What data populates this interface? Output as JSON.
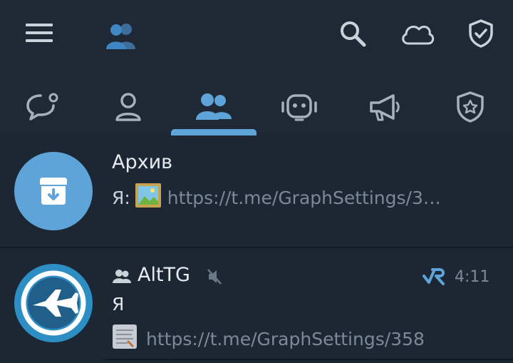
{
  "header": {
    "menu_icon": "hamburger-menu-icon",
    "contacts_icon": "people-emoji-icon",
    "search_icon": "search-icon",
    "cloud_icon": "cloud-icon",
    "shield_icon": "shield-check-icon"
  },
  "tabs": [
    {
      "icon": "chat-bubble-icon",
      "active": false
    },
    {
      "icon": "person-icon",
      "active": false
    },
    {
      "icon": "group-icon",
      "active": true
    },
    {
      "icon": "robot-icon",
      "active": false
    },
    {
      "icon": "megaphone-icon",
      "active": false
    },
    {
      "icon": "star-shield-icon",
      "active": false
    }
  ],
  "chats": [
    {
      "title": "Архив",
      "sender": "Я:",
      "preview": "https://t.me/GraphSettings/3…",
      "avatar_color": "#5fa4d9"
    },
    {
      "title": "AltTG",
      "time": "4:11",
      "message_line": "Я",
      "preview": "https://t.me/GraphSettings/358",
      "muted": true,
      "avatar_color": "#2d8ec4"
    }
  ],
  "colors": {
    "background": "#1d2733",
    "accent": "#5fa4d9",
    "icon": "#b3bcc6",
    "muted_text": "#7c8a98"
  }
}
